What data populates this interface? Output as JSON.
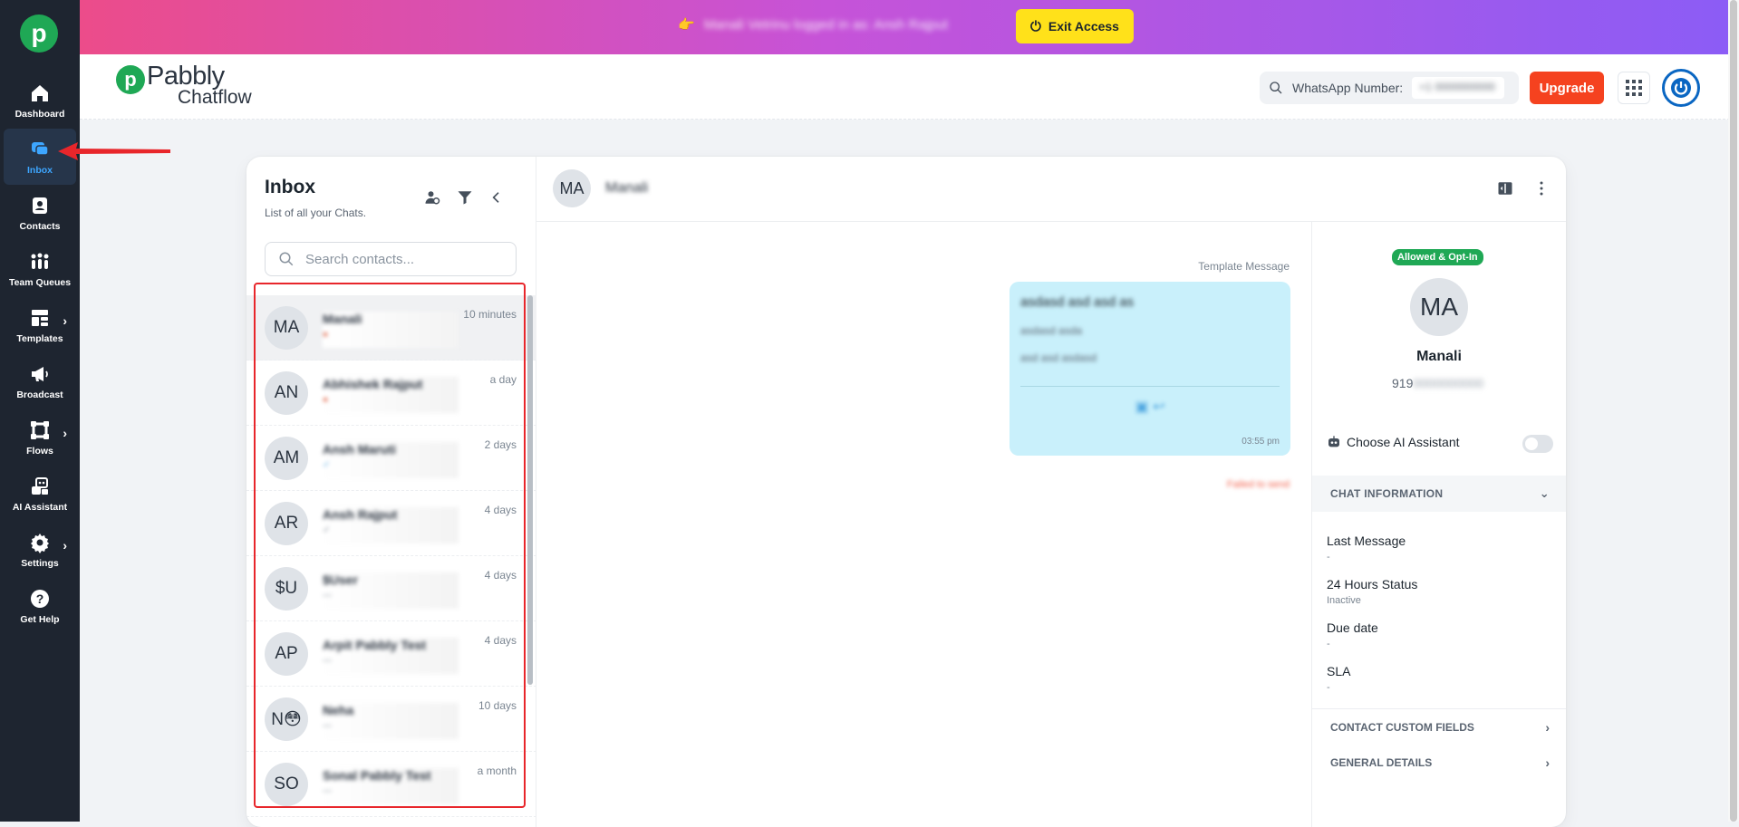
{
  "topbar": {
    "impersonation_text": "Manali Vetrinu logged in as: Ansh Rajput",
    "exit_label": "Exit Access"
  },
  "sidebar": {
    "items": [
      {
        "label": "Dashboard",
        "icon": "home-icon"
      },
      {
        "label": "Inbox",
        "icon": "chat-icon"
      },
      {
        "label": "Contacts",
        "icon": "contact-icon"
      },
      {
        "label": "Team Queues",
        "icon": "team-icon"
      },
      {
        "label": "Templates",
        "icon": "template-icon"
      },
      {
        "label": "Broadcast",
        "icon": "megaphone-icon"
      },
      {
        "label": "Flows",
        "icon": "flow-icon"
      },
      {
        "label": "AI Assistant",
        "icon": "robot-icon"
      },
      {
        "label": "Settings",
        "icon": "gear-icon"
      },
      {
        "label": "Get Help",
        "icon": "help-icon"
      }
    ]
  },
  "header": {
    "brand_line1": "Pabbly",
    "brand_line2": "Chatflow",
    "whatsapp_label": "WhatsApp Number:",
    "whatsapp_value": "+1 0000000000",
    "upgrade_label": "Upgrade"
  },
  "inbox": {
    "title": "Inbox",
    "subtitle": "List of all your Chats.",
    "search_placeholder": "Search contacts...",
    "chats": [
      {
        "initials": "MA",
        "name": "Manali",
        "preview": "●",
        "time": "10 minutes"
      },
      {
        "initials": "AN",
        "name": "Abhishek Rajput",
        "preview": "●",
        "time": "a day"
      },
      {
        "initials": "AM",
        "name": "Ansh Maruti",
        "preview": "✓",
        "time": "2 days"
      },
      {
        "initials": "AR",
        "name": "Ansh Rajput",
        "preview": "✓",
        "time": "4 days"
      },
      {
        "initials": "$U",
        "name": "$User",
        "preview": "—",
        "time": "4 days"
      },
      {
        "initials": "AP",
        "name": "Arpit Pabbly Test",
        "preview": "—",
        "time": "4 days"
      },
      {
        "initials": "N😳",
        "name": "Neha",
        "preview": "—",
        "time": "10 days"
      },
      {
        "initials": "SO",
        "name": "Sonal Pabbly Test",
        "preview": "—",
        "time": "a month"
      }
    ]
  },
  "chat": {
    "contact_initials": "MA",
    "contact_name": "Manali",
    "template_label": "Template Message",
    "bubble_line1": "asdasd asd asd as",
    "bubble_line2": "asdasd asda",
    "bubble_line3": "asd asd asdasd",
    "bubble_actions": "▣  ↩",
    "bubble_time": "03:55 pm",
    "status_text": "Failed to send"
  },
  "profile": {
    "badge": "Allowed & Opt-In",
    "initials": "MA",
    "name": "Manali",
    "phone_prefix": "919",
    "phone_hidden": "0000000000",
    "ai_label": "Choose AI Assistant",
    "chat_info_header": "CHAT INFORMATION",
    "fields": [
      {
        "label": "Last Message",
        "value": "-"
      },
      {
        "label": "24 Hours Status",
        "value": "Inactive"
      },
      {
        "label": "Due date",
        "value": "-"
      },
      {
        "label": "SLA",
        "value": "-"
      }
    ],
    "custom_fields_header": "CONTACT CUSTOM FIELDS",
    "general_details_header": "GENERAL DETAILS"
  },
  "colors": {
    "brand_green": "#1fa855",
    "upgrade_orange": "#f5421f",
    "exit_yellow": "#ffe11a",
    "sidebar_bg": "#1e2530",
    "active_blue": "#3da6ff",
    "highlight_red": "#e8262b",
    "bubble_blue": "#c9f0fb"
  }
}
